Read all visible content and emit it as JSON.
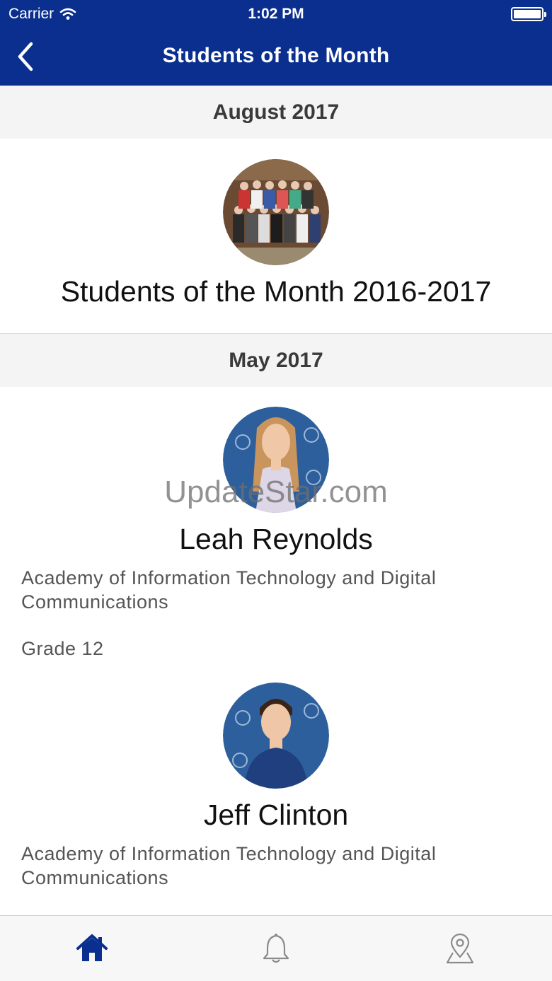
{
  "status_bar": {
    "carrier": "Carrier",
    "time": "1:02 PM"
  },
  "nav": {
    "title": "Students of the Month",
    "back_icon": "chevron-left-icon"
  },
  "sections": [
    {
      "header": "August 2017",
      "items": [
        {
          "title": "Students of the Month 2016-2017"
        }
      ]
    },
    {
      "header": "May 2017",
      "items": [
        {
          "name": "Leah Reynolds",
          "academy": "Academy of Information Technology and Digital Communications",
          "grade": "Grade 12"
        },
        {
          "name": "Jeff Clinton",
          "academy": "Academy of Information Technology and Digital Communications"
        }
      ]
    }
  ],
  "watermark": "UpdateStar.com",
  "tabbar": {
    "tabs": [
      {
        "icon": "home-icon",
        "active": true
      },
      {
        "icon": "bell-icon",
        "active": false
      },
      {
        "icon": "map-pin-icon",
        "active": false
      }
    ]
  },
  "colors": {
    "brand": "#0a2f8f",
    "tab_inactive": "#8a8a8a",
    "section_bg": "#f4f4f4"
  }
}
